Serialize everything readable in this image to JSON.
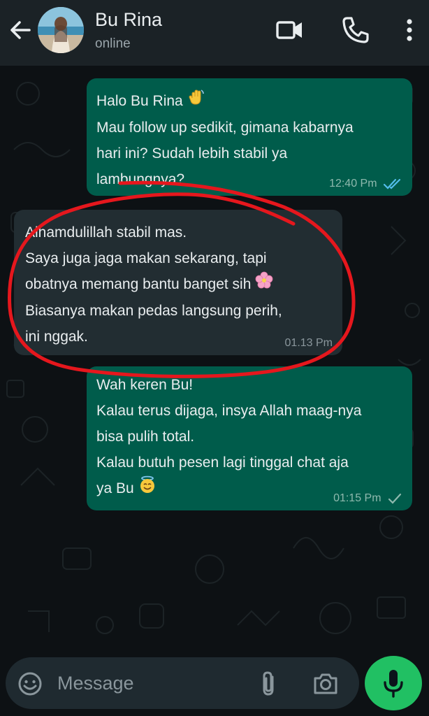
{
  "header": {
    "contact_name": "Bu Rina",
    "status": "online",
    "icons": [
      "back-arrow-icon",
      "video-call-icon",
      "voice-call-icon",
      "more-vert-icon"
    ]
  },
  "messages": [
    {
      "direction": "outgoing",
      "lines": [
        "Halo Bu Rina",
        "Mau follow up sedikit, gimana kabarnya",
        "hari ini? Sudah lebih stabil ya",
        "lambungnya?"
      ],
      "emoji": "waving-hand",
      "time": "12:40 Pm",
      "status": "read"
    },
    {
      "direction": "incoming",
      "lines": [
        "Alhamdulillah stabil mas.",
        "Saya juga jaga makan sekarang, tapi",
        "obatnya memang bantu banget sih",
        "Biasanya makan pedas langsung perih,",
        "ini nggak."
      ],
      "emoji": "blossom",
      "time": "01.13 Pm"
    },
    {
      "direction": "outgoing",
      "lines": [
        "Wah keren Bu!",
        "Kalau terus dijaga, insya Allah maag-nya",
        "bisa pulih total.",
        "Kalau butuh pesen lagi tinggal chat aja",
        "ya Bu"
      ],
      "emoji": "smiling-face-with-halo",
      "time": "01:15 Pm",
      "status": "sent"
    }
  ],
  "composer": {
    "placeholder": "Message",
    "icons": [
      "emoji-icon",
      "attach-icon",
      "camera-icon",
      "mic-icon"
    ]
  },
  "annotation": {
    "type": "red hand-drawn circle around incoming message",
    "color": "#e5171d"
  },
  "colors": {
    "header_bg": "#1b2226",
    "outgoing_bubble": "#005c4b",
    "incoming_bubble": "#222d32",
    "accent_green": "#21c063",
    "read_tick": "#53bdeb"
  }
}
